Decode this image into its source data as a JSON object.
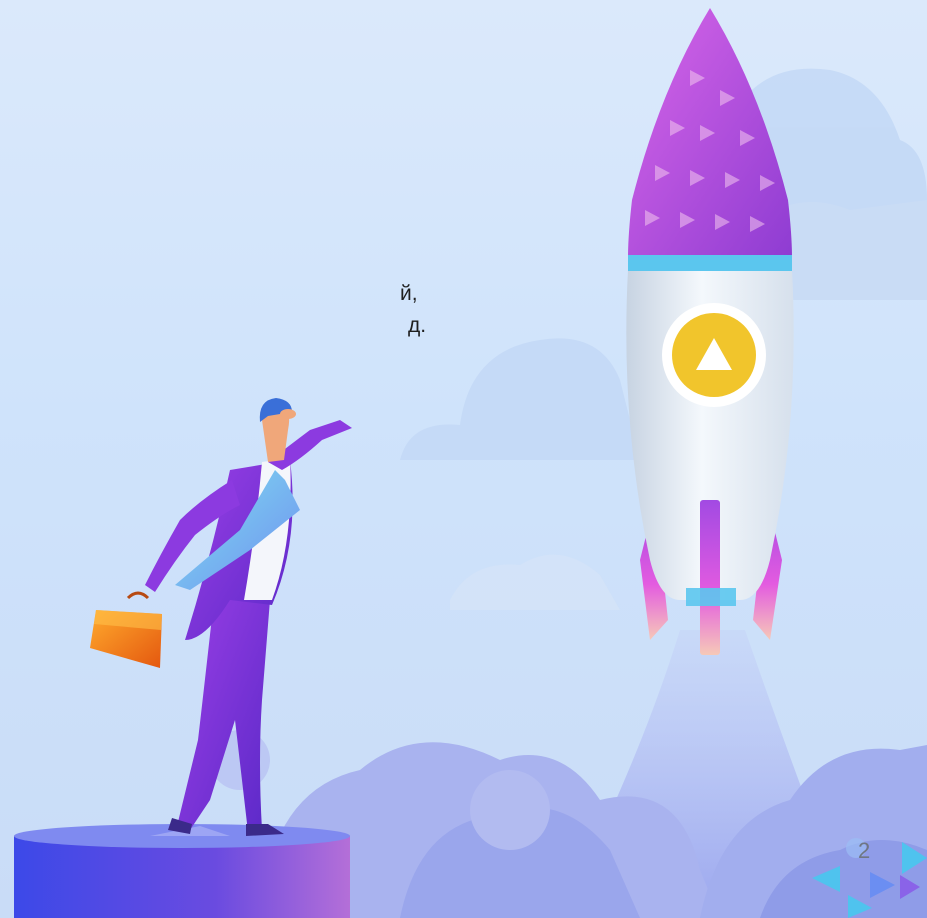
{
  "slide": {
    "text_fragments": [
      "й,",
      "д."
    ],
    "page_number": "2"
  },
  "illustration": {
    "elements": [
      "rocket",
      "businessman-with-briefcase",
      "clouds",
      "pedestal",
      "logo-mark"
    ],
    "colors": {
      "rocket_nose": "#b44ee0",
      "rocket_body": "#eaf1f8",
      "rocket_badge": "#f3c82c",
      "suit": "#7a2fd6",
      "briefcase": "#f28a1c",
      "pedestal": "#4e54e6",
      "clouds": "#a7b5f2"
    }
  }
}
